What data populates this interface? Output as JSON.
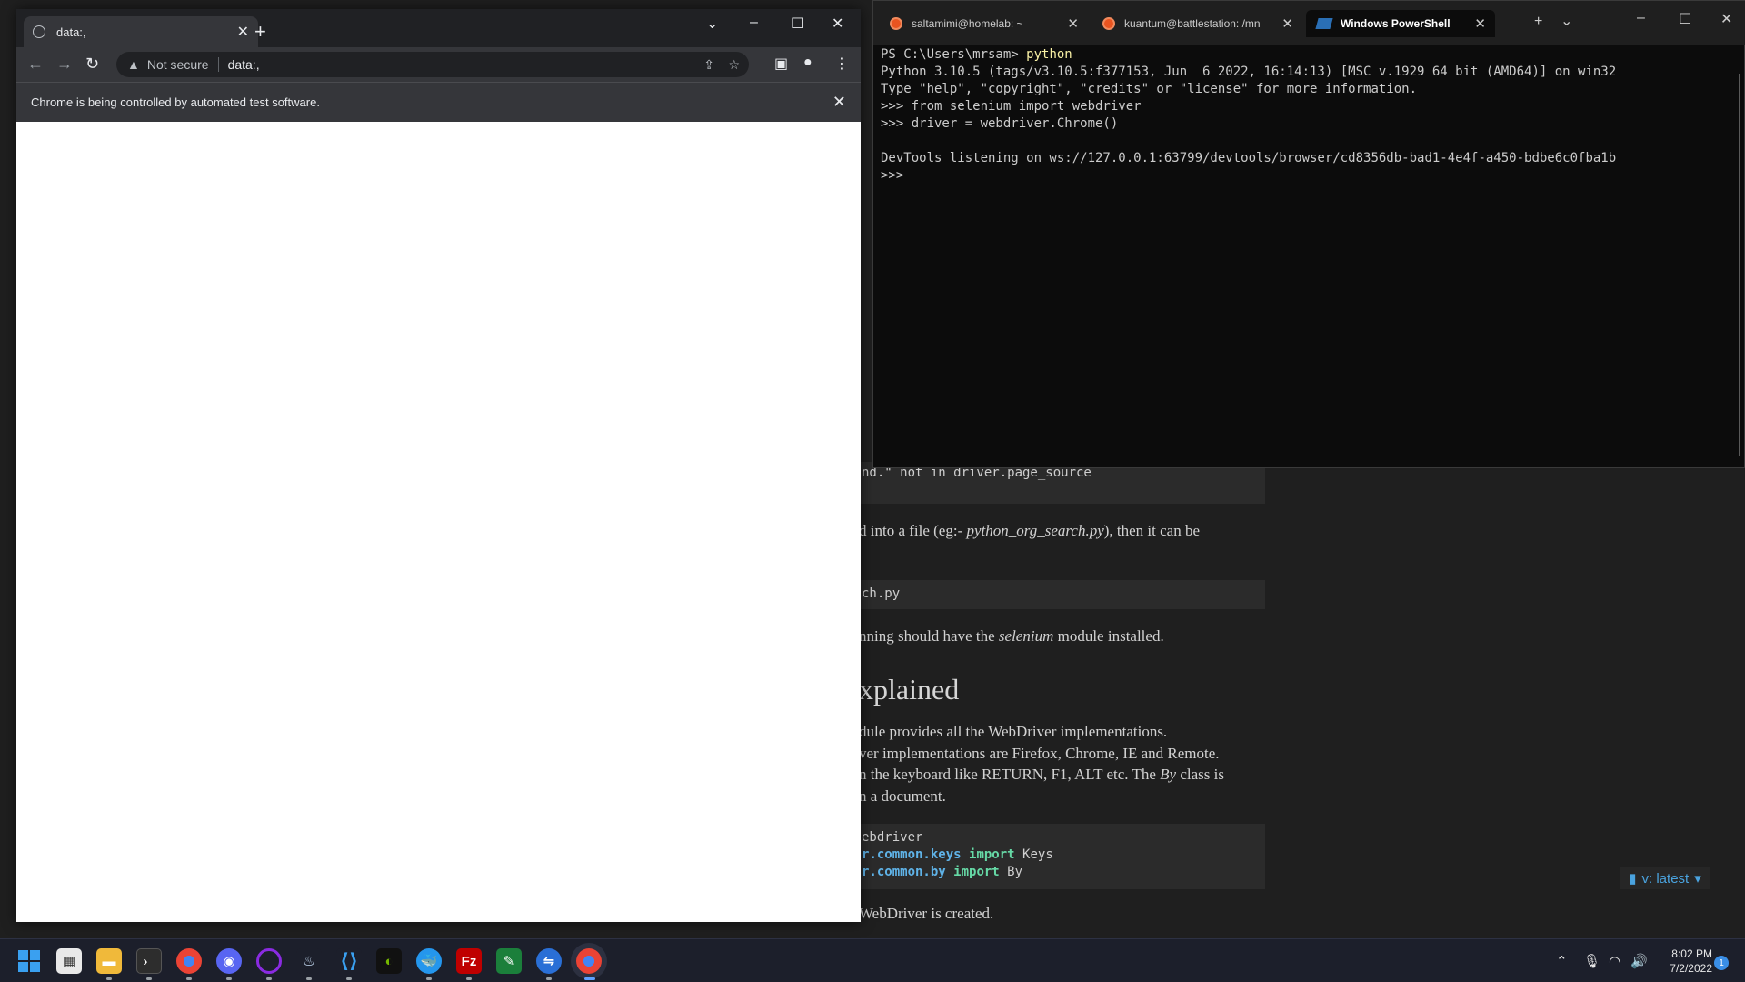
{
  "background_doc": {
    "code_line_not_in": "nd.\" not in driver.page_source",
    "para1_a": "d into a file (eg:- ",
    "para1_file": "python_org_search.py",
    "para1_b": "), then it can be",
    "code_run": "ch.py",
    "para2_a": "nning should have the ",
    "para2_mod": "selenium",
    "para2_b": " module installed.",
    "heading": "xplained",
    "para3_l1": "dule provides all the WebDriver implementations.",
    "para3_l2": "ver implementations are Firefox, Chrome, IE and Remote.",
    "para3_l3a": "n the keyboard like RETURN, F1, ALT etc. The ",
    "para3_l3b": "By",
    "para3_l3c": " class is",
    "para3_l4": "n a document.",
    "import1": "ebdriver",
    "import2_mod": "r.common.keys",
    "import2_kw": "import",
    "import2_name": "Keys",
    "import3_mod": "r.common.by",
    "import3_kw": "import",
    "import3_name": "By",
    "para4": "WebDriver is created.",
    "version_badge": "v: latest"
  },
  "chrome": {
    "tab_title": "data:,",
    "address_warning": "Not secure",
    "address_url": "data:,",
    "infobar_text": "Chrome is being controlled by automated test software."
  },
  "terminal": {
    "tabs": [
      {
        "label": "saltamimi@homelab: ~",
        "icon": "ubuntu-icon"
      },
      {
        "label": "kuantum@battlestation: /mn",
        "icon": "ubuntu-icon"
      },
      {
        "label": "Windows PowerShell",
        "icon": "powershell-icon"
      }
    ],
    "lines": {
      "l1_prefix": "PS C:\\Users\\mrsam> ",
      "l1_cmd": "python",
      "l2": "Python 3.10.5 (tags/v3.10.5:f377153, Jun  6 2022, 16:14:13) [MSC v.1929 64 bit (AMD64)] on win32",
      "l3": "Type \"help\", \"copyright\", \"credits\" or \"license\" for more information.",
      "l4": ">>> from selenium import webdriver",
      "l5": ">>> driver = webdriver.Chrome()",
      "l6": "",
      "l7": "DevTools listening on ws://127.0.0.1:63799/devtools/browser/cd8356db-bad1-4e4f-a450-bdbe6c0fba1b",
      "l8": ">>> "
    }
  },
  "taskbar": {
    "apps": [
      "windows-start-icon",
      "microsoft-store-icon",
      "file-explorer-icon",
      "terminal-icon",
      "chrome-icon",
      "discord-icon",
      "obs-icon",
      "steam-icon",
      "vscode-icon",
      "nvidia-icon",
      "docker-icon",
      "filezilla-icon",
      "notepad-icon",
      "remote-desktop-icon",
      "chrome-active-icon"
    ],
    "time": "8:02 PM",
    "date": "7/2/2022",
    "notification_count": "1"
  }
}
